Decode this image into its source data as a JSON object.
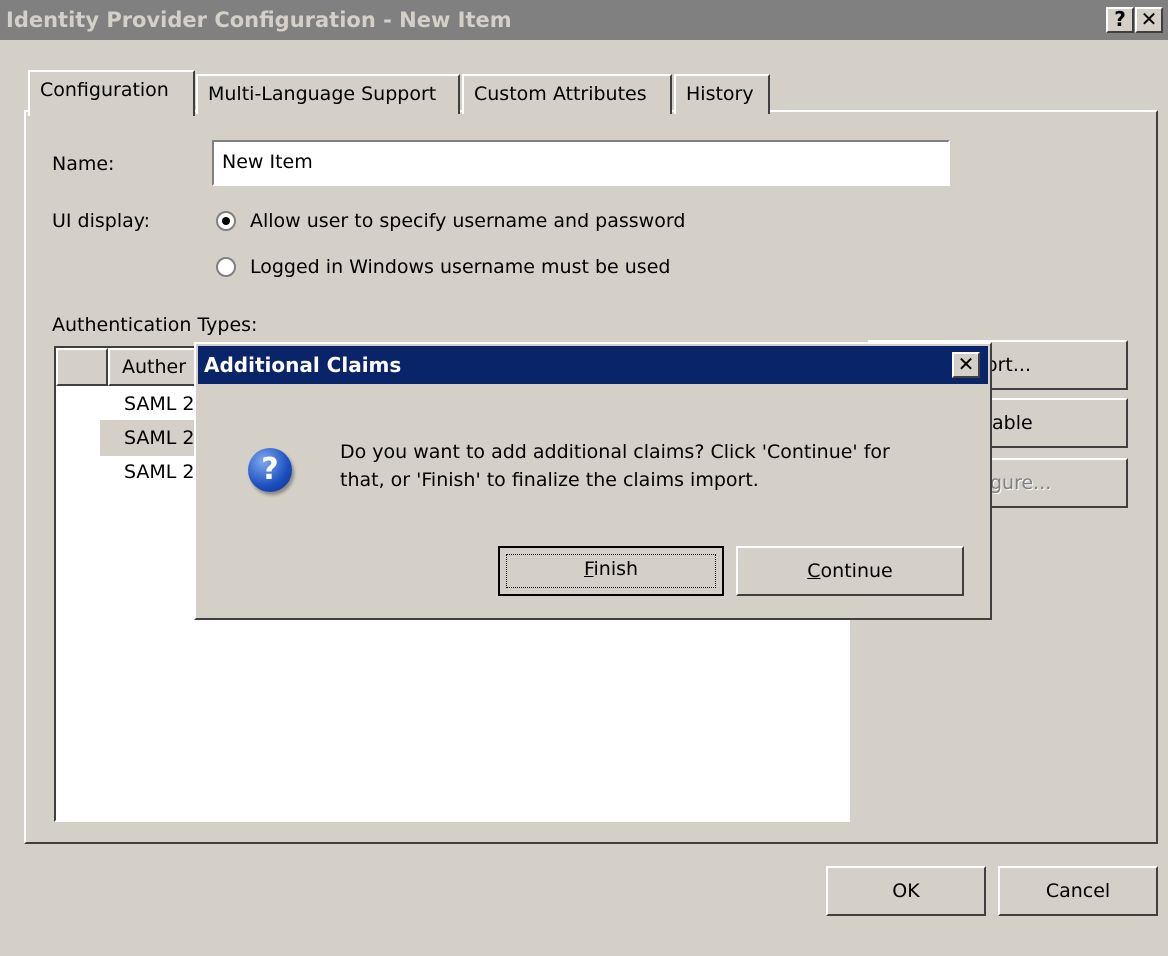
{
  "window": {
    "title": "Identity Provider Configuration - New Item",
    "help_button": "?",
    "close_button": "✕"
  },
  "tabs": [
    {
      "label": "Configuration",
      "active": true
    },
    {
      "label": "Multi-Language Support",
      "active": false
    },
    {
      "label": "Custom Attributes",
      "active": false
    },
    {
      "label": "History",
      "active": false
    }
  ],
  "form": {
    "name_label": "Name:",
    "name_value": "New Item",
    "ui_display_label": "UI display:",
    "radio_options": [
      {
        "label": "Allow user to specify username and password",
        "checked": true
      },
      {
        "label": "Logged in Windows username must be used",
        "checked": false
      }
    ],
    "auth_types_label": "Authentication Types:"
  },
  "auth_list": {
    "header": "Auther",
    "rows": [
      "SAML 2",
      "SAML 2",
      "SAML 2"
    ],
    "selected_row": 1
  },
  "side_buttons": {
    "import_label": "ort...",
    "enable_label": "able",
    "configure_label": "gure..."
  },
  "bottom_buttons": {
    "ok_label": "OK",
    "cancel_label": "Cancel"
  },
  "dialog": {
    "title": "Additional Claims",
    "close": "✕",
    "message_line1": "Do you want to add additional claims? Click 'Continue' for",
    "message_line2": "that, or 'Finish' to finalize the claims import.",
    "icon": "question-icon",
    "finish_mnemonic": "F",
    "finish_rest": "inish",
    "continue_mnemonic": "C",
    "continue_rest": "ontinue"
  },
  "colors": {
    "face": "#d4d0c8",
    "inactive_title": "#808080",
    "active_title": "#0a246a"
  }
}
